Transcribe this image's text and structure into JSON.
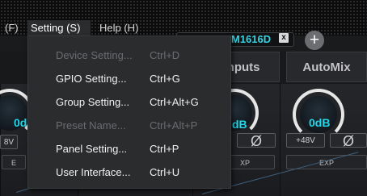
{
  "menubar": {
    "partial_menu": "(F)",
    "setting_menu": "Setting (S)",
    "help_menu": "Help (H)"
  },
  "device_tab": {
    "name": "M1616D",
    "close_label": "x",
    "add_label": "+"
  },
  "tabs": [
    {
      "label": "Inputs"
    },
    {
      "label": "AutoMix"
    }
  ],
  "channels": {
    "left": {
      "level": "0d",
      "phantom": "8V",
      "exp": "E"
    },
    "middle": {
      "level": "dB",
      "phase": "Ø",
      "exp": "XP"
    },
    "right": {
      "level": "0dB",
      "phantom": "+48V",
      "phase": "Ø",
      "exp": "EXP"
    }
  },
  "setting_menu": {
    "items": [
      {
        "label": "Device Setting...",
        "shortcut": "Ctrl+D",
        "enabled": false
      },
      {
        "label": "GPIO Setting...",
        "shortcut": "Ctrl+G",
        "enabled": true
      },
      {
        "label": "Group Setting...",
        "shortcut": "Ctrl+Alt+G",
        "enabled": true
      },
      {
        "label": "Preset Name...",
        "shortcut": "Ctrl+Alt+P",
        "enabled": false
      },
      {
        "label": "Panel Setting...",
        "shortcut": "Ctrl+P",
        "enabled": true
      },
      {
        "label": "User Interface...",
        "shortcut": "Ctrl+U",
        "enabled": true
      }
    ]
  },
  "colors": {
    "accent": "#35d3e2",
    "menu_bg": "#2b2c2e",
    "disabled_text": "#6b6c6f"
  }
}
